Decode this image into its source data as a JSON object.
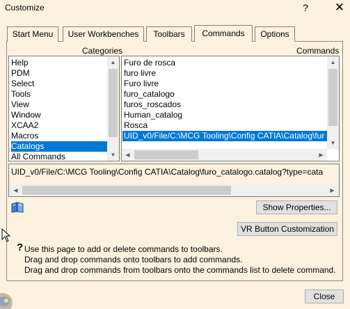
{
  "window": {
    "title": "Customize",
    "help_glyph": "?",
    "close_glyph": "✕"
  },
  "tabs": [
    {
      "label": "Start Menu"
    },
    {
      "label": "User Workbenches"
    },
    {
      "label": "Toolbars"
    },
    {
      "label": "Commands",
      "active": true
    },
    {
      "label": "Options"
    }
  ],
  "categories": {
    "header": "Categories",
    "items": [
      "Help",
      "PDM",
      "Select",
      "Tools",
      "View",
      "Window",
      "XCAA2",
      "Macros",
      "Catalogs",
      "All Commands"
    ],
    "selected": "Catalogs"
  },
  "commands": {
    "header": "Commands",
    "items": [
      "Furo de rosca",
      "furo livre",
      "Furo livre",
      "furo_catalogo",
      "furos_roscados",
      "Human_catalog",
      "Rosca",
      "UID_v0/File/C:\\MCG Tooling\\Config CATIA\\Catalog\\fur"
    ],
    "selected_index": 7
  },
  "selected_path": "UID_v0/File/C:\\MCG Tooling\\Config CATIA\\Catalog\\furo_catalogo.catalog?type=cata",
  "buttons": {
    "show_properties": "Show Properties...",
    "vr_customization": "VR Button Customization",
    "close": "Close"
  },
  "info": {
    "line1": "Use this page to add or delete commands to toolbars.",
    "line2": "Drag and drop commands onto toolbars to add commands.",
    "line3": "Drag and drop commands from toolbars onto the commands list to delete command."
  },
  "icons": {
    "help": "help-question-icon",
    "book": "catalog-book-icon",
    "info": "question-mark-icon",
    "cursor": "mouse-pointer-icon"
  },
  "colors": {
    "background": "#fdf2df",
    "selection": "#0078d7",
    "button_face": "#e1e1e1"
  }
}
